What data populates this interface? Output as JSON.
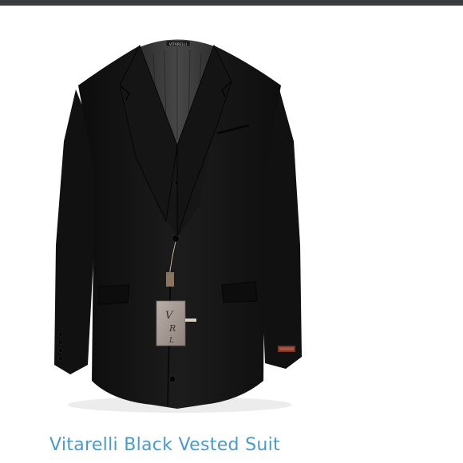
{
  "header": {
    "bar_color": "#3a3c40"
  },
  "product": {
    "title": "Vitarelli Black Vested Suit",
    "title_color": "#4a9bc9",
    "image": {
      "subject": "black three-piece suit jacket with vest",
      "hang_tag_text": "VRL",
      "collar_label_text": "VITARELLI"
    }
  }
}
